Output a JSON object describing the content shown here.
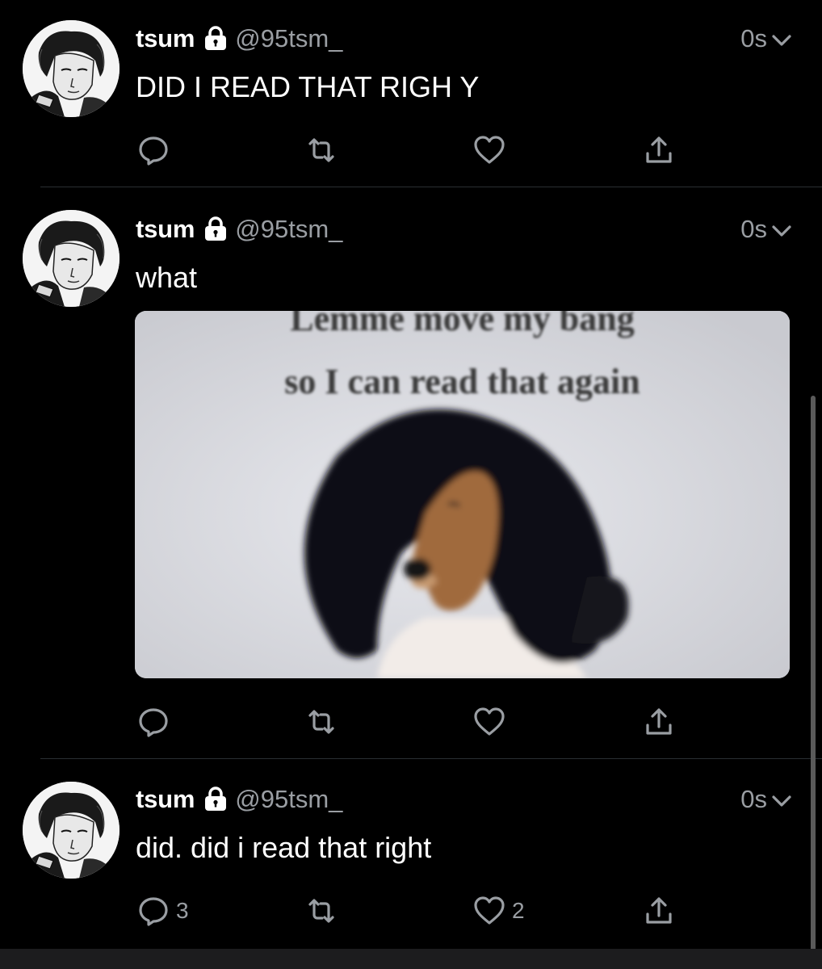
{
  "tweets": [
    {
      "name": "tsum",
      "handle": "@95tsm_",
      "time": "0s",
      "text": "DID I READ THAT RIGH Y",
      "reply_count": "",
      "like_count": ""
    },
    {
      "name": "tsum",
      "handle": "@95tsm_",
      "time": "0s",
      "text": "what",
      "media": {
        "caption_line1": "Lemme move my bang",
        "caption_line2": "so I can read that again"
      },
      "reply_count": "",
      "like_count": ""
    },
    {
      "name": "tsum",
      "handle": "@95tsm_",
      "time": "0s",
      "text": "did. did i read that right",
      "reply_count": "3",
      "like_count": "2"
    }
  ],
  "icons": {
    "protected": "lock-icon",
    "menu": "chevron-down-icon",
    "reply": "reply-icon",
    "retweet": "retweet-icon",
    "like": "heart-icon",
    "share": "share-icon"
  },
  "colors": {
    "background": "#000000",
    "text": "#ffffff",
    "secondary_text": "#9a9ea3",
    "divider": "#2a2f33"
  }
}
